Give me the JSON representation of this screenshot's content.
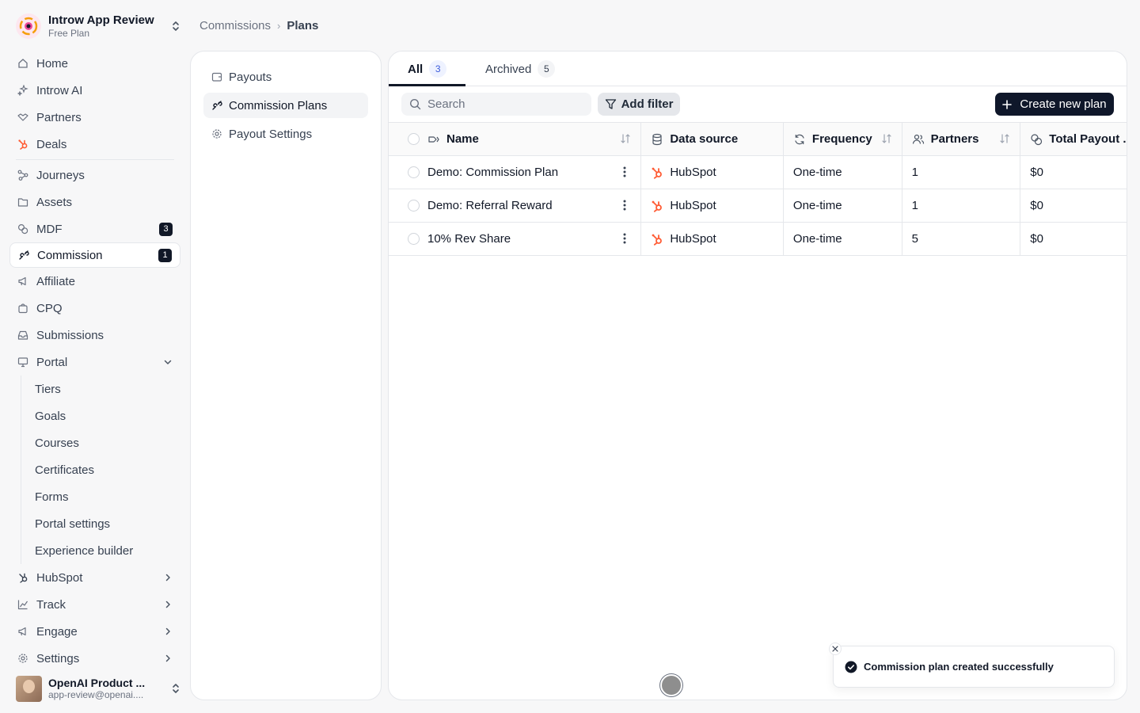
{
  "workspace": {
    "name": "Introw App Review",
    "plan": "Free Plan"
  },
  "sidebar": {
    "items": [
      {
        "label": "Home",
        "icon": "home-icon"
      },
      {
        "label": "Introw AI",
        "icon": "sparkle-icon"
      },
      {
        "label": "Partners",
        "icon": "handshake-icon"
      },
      {
        "label": "Deals",
        "icon": "hubspot-icon"
      },
      {
        "label": "Journeys",
        "icon": "journey-icon"
      },
      {
        "label": "Assets",
        "icon": "folder-icon"
      },
      {
        "label": "MDF",
        "icon": "coins-icon",
        "badge": "3"
      },
      {
        "label": "Commission",
        "icon": "commission-icon",
        "badge": "1",
        "active": true
      },
      {
        "label": "Affiliate",
        "icon": "megaphone-icon"
      },
      {
        "label": "CPQ",
        "icon": "bag-icon"
      },
      {
        "label": "Submissions",
        "icon": "inbox-icon"
      },
      {
        "label": "Portal",
        "icon": "monitor-icon"
      }
    ],
    "portal_sub": [
      "Tiers",
      "Goals",
      "Courses",
      "Certificates",
      "Forms",
      "Portal settings",
      "Experience builder"
    ],
    "bottom_items": [
      {
        "label": "HubSpot",
        "icon": "hubspot-icon"
      },
      {
        "label": "Track",
        "icon": "chart-icon"
      },
      {
        "label": "Engage",
        "icon": "megaphone-icon"
      },
      {
        "label": "Settings",
        "icon": "gear-icon"
      }
    ]
  },
  "user": {
    "name": "OpenAI Product ...",
    "email": "app-review@openai...."
  },
  "breadcrumb": {
    "parent": "Commissions",
    "current": "Plans"
  },
  "subnav": [
    {
      "label": "Payouts",
      "icon": "wallet-icon"
    },
    {
      "label": "Commission Plans",
      "icon": "commission-icon",
      "active": true
    },
    {
      "label": "Payout Settings",
      "icon": "gear-icon"
    }
  ],
  "tabs": [
    {
      "label": "All",
      "count": "3",
      "active": true
    },
    {
      "label": "Archived",
      "count": "5"
    }
  ],
  "search": {
    "placeholder": "Search"
  },
  "toolbar": {
    "filter_label": "Add filter",
    "create_label": "Create new plan"
  },
  "table": {
    "headers": {
      "name": "Name",
      "source": "Data source",
      "frequency": "Frequency",
      "partners": "Partners",
      "total": "Total Payout ..."
    },
    "rows": [
      {
        "name": "Demo: Commission Plan",
        "source": "HubSpot",
        "frequency": "One-time",
        "partners": "1",
        "total": "$0"
      },
      {
        "name": "Demo: Referral Reward",
        "source": "HubSpot",
        "frequency": "One-time",
        "partners": "1",
        "total": "$0"
      },
      {
        "name": "10% Rev Share",
        "source": "HubSpot",
        "frequency": "One-time",
        "partners": "5",
        "total": "$0"
      }
    ]
  },
  "toast": {
    "message": "Commission plan created successfully"
  },
  "colors": {
    "primary": "#0f172a",
    "hubspot": "#ff5c35",
    "accent_count": "#3b5bdb"
  }
}
